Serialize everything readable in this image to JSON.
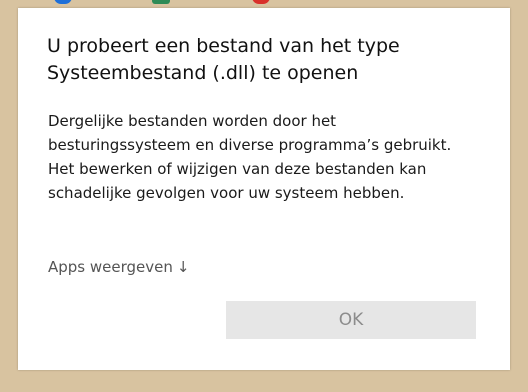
{
  "dialog": {
    "title_line1": "U probeert een bestand van het type",
    "title_line2": "Systeembestand (.dll) te openen",
    "body_line1": "Dergelijke bestanden worden door het",
    "body_line2": "besturingssysteem en diverse programma’s gebruikt.",
    "body_line3": "Het bewerken of wijzigen van deze bestanden kan",
    "body_line4": "schadelijke gevolgen voor uw systeem hebben.",
    "apps_link_label": "Apps weergeven",
    "apps_link_icon": "↓",
    "ok_label": "OK"
  },
  "colors": {
    "desktop_background": "#d8c3a0",
    "icon_blue": "#1e6fd9",
    "icon_green": "#2e8b57",
    "icon_red": "#d9302b",
    "button_background": "#e6e6e6",
    "button_text": "#8c8c8c"
  }
}
